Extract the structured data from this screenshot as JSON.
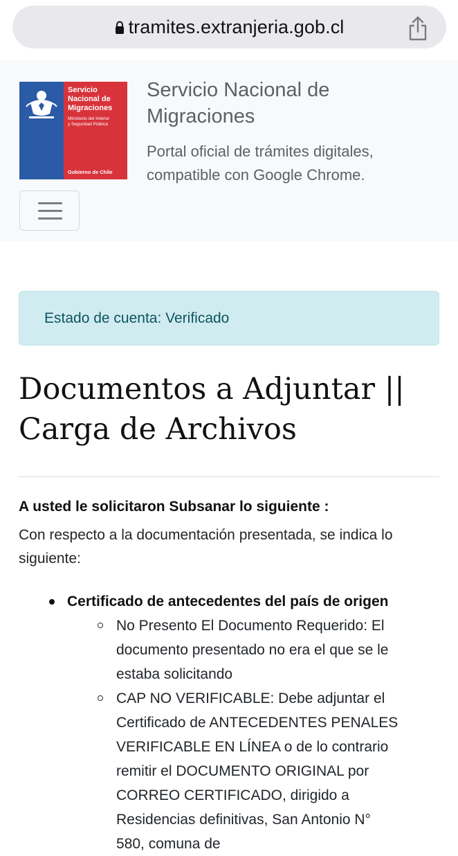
{
  "browser": {
    "url": "tramites.extranjeria.gob.cl"
  },
  "header": {
    "logo": {
      "title_line1": "Servicio",
      "title_line2": "Nacional de",
      "title_line3": "Migraciones",
      "sub_line1": "Ministerio del Interior",
      "sub_line2": "y Seguridad Pública",
      "gov": "Gobierno de Chile"
    },
    "title_line1": "Servicio Nacional de",
    "title_line2": "Migraciones",
    "subtitle_line1": "Portal oficial de trámites digitales,",
    "subtitle_line2": "compatible con Google Chrome."
  },
  "alert": {
    "text": "Estado de cuenta: Verificado"
  },
  "page": {
    "title_line1": "Documentos a Adjuntar ||",
    "title_line2": "Carga de Archivos",
    "request_label": "A usted le solicitaron Subsanar lo siguiente :",
    "intro_line1": "Con respecto a la documentación presentada, se indica lo",
    "intro_line2": "siguiente:",
    "documents": [
      {
        "name": "Certificado de antecedentes del país de origen",
        "observations": [
          "No Presento El Documento Requerido: El documento presentado no era el que se le estaba solicitando",
          "CAP NO VERIFICABLE: Debe adjuntar el Certificado de ANTECEDENTES PENALES VERIFICABLE EN LÍNEA o de lo contrario remitir el DOCUMENTO ORIGINAL por CORREO CERTIFICADO, dirigido a Residencias definitivas, San Antonio N° 580, comuna de"
        ]
      }
    ]
  },
  "colors": {
    "logo_blue": "#2b5aa6",
    "logo_red": "#d8333a",
    "alert_bg": "#d1ecf1",
    "alert_text": "#0c5460"
  }
}
